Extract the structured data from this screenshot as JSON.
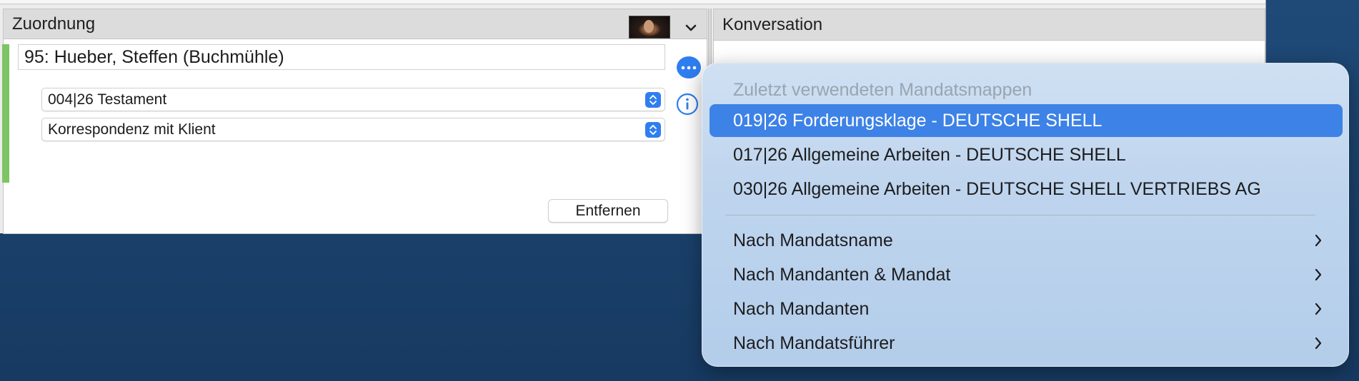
{
  "window": {
    "left_pane": {
      "title": "Zuordnung",
      "client": "95: Hueber, Steffen (Buchmühle)",
      "mandate_select": "004|26 Testament",
      "category_select": "Korrespondenz mit Klient",
      "remove_button": "Entfernen"
    },
    "right_pane": {
      "title": "Konversation"
    }
  },
  "menu": {
    "header": "Zuletzt verwendeten Mandatsmappen",
    "recent": [
      {
        "label": "019|26 Forderungsklage - DEUTSCHE SHELL",
        "selected": true
      },
      {
        "label": "017|26 Allgemeine Arbeiten - DEUTSCHE SHELL",
        "selected": false
      },
      {
        "label": "030|26 Allgemeine Arbeiten - DEUTSCHE SHELL VERTRIEBS AG",
        "selected": false
      }
    ],
    "submenus": [
      {
        "label": "Nach Mandatsname"
      },
      {
        "label": "Nach Mandanten & Mandat"
      },
      {
        "label": "Nach Mandanten"
      },
      {
        "label": "Nach Mandatsführer"
      }
    ]
  },
  "colors": {
    "accent": "#3d82e6",
    "green_marker": "#7dc463",
    "desktop": "#1b426c"
  }
}
